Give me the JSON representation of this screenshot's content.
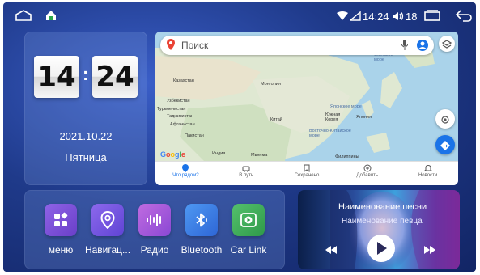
{
  "statusbar": {
    "time": "14:24",
    "volume": "18"
  },
  "clock": {
    "hours": "14",
    "minutes": "24",
    "separator": ":",
    "date": "2021.10.22",
    "weekday": "Пятница"
  },
  "map": {
    "search_placeholder": "Поиск",
    "labels": [
      "Казахстан",
      "Монголия",
      "Узбекистан",
      "Туркменистан",
      "Таджикистан",
      "Китай",
      "Афганистан",
      "Пакистан",
      "Индия",
      "Мьянма",
      "Южная Корея",
      "Япония",
      "Восточно-Китайское море",
      "Охотское море",
      "Японское море",
      "Филиппины"
    ],
    "google_logo": "Google",
    "nav": [
      {
        "label": "Что рядом?",
        "active": true
      },
      {
        "label": "В путь",
        "active": false
      },
      {
        "label": "Сохранено",
        "active": false
      },
      {
        "label": "Добавить",
        "active": false
      },
      {
        "label": "Новости",
        "active": false
      }
    ]
  },
  "apps": [
    {
      "label": "меню",
      "icon": "menu-grid-icon",
      "color": "#7b4fd6"
    },
    {
      "label": "Навигац...",
      "icon": "location-pin-icon",
      "color": "#7a56e0"
    },
    {
      "label": "Радио",
      "icon": "radio-wave-icon",
      "color": "#b05ad8"
    },
    {
      "label": "Bluetooth",
      "icon": "bluetooth-icon",
      "color": "#3a7ee8"
    },
    {
      "label": "Car Link",
      "icon": "car-link-icon",
      "color": "#3aa85a"
    }
  ],
  "music": {
    "title": "Наименование песни",
    "artist": "Наименование певца"
  },
  "colors": {
    "accent": "#1a73e8",
    "background": "#1f3a8a"
  }
}
